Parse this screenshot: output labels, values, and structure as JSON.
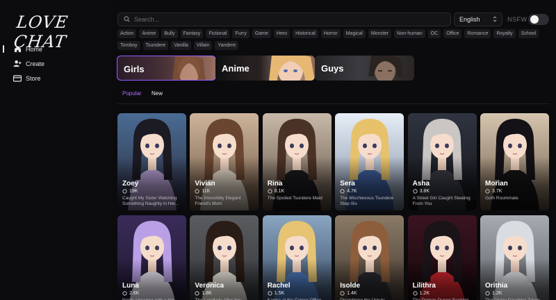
{
  "app": {
    "logo": "LOVE CHAT"
  },
  "sidebar": {
    "items": [
      {
        "label": "Home",
        "icon": "home-icon",
        "active": true
      },
      {
        "label": "Create",
        "icon": "add-user-icon",
        "active": false
      },
      {
        "label": "Store",
        "icon": "store-icon",
        "active": false
      }
    ]
  },
  "header": {
    "search_placeholder": "Search...",
    "language": "English",
    "nsfw_label": "NSFW",
    "nsfw_enabled": false
  },
  "tags": [
    "Action",
    "Anime",
    "Bully",
    "Fantasy",
    "Fictional",
    "Furry",
    "Game",
    "Hero",
    "Historical",
    "Horror",
    "Magical",
    "Monster",
    "Non-human",
    "OC",
    "Office",
    "Romance",
    "Royalty",
    "School",
    "Tomboy",
    "Tsundere",
    "Vanilla",
    "Villain",
    "Yandere"
  ],
  "categories": [
    {
      "label": "Girls",
      "selected": true
    },
    {
      "label": "Anime",
      "selected": false
    },
    {
      "label": "Guys",
      "selected": false
    }
  ],
  "sort": {
    "popular": "Popular",
    "new": "New",
    "active": "popular"
  },
  "colors": {
    "accent": "#9b5cff",
    "accent_text": "#b46cff",
    "background": "#0b0b0d"
  },
  "cards": [
    {
      "name": "Zoey",
      "likes": "19K",
      "desc": "Caught My Sister Watching Something Naughty in Her...",
      "bg": [
        "#4a6c94",
        "#2b2b3c"
      ],
      "hair": "#1c1a22",
      "outfit": "#b9a2d8"
    },
    {
      "name": "Vivian",
      "likes": "11K",
      "desc": "The Irresistibly Elegant Friend's Mom",
      "bg": [
        "#cdb49a",
        "#6e5544"
      ],
      "hair": "#6a4630",
      "outfit": "#e9dccd"
    },
    {
      "name": "Rina",
      "likes": "8.1K",
      "desc": "The Spoiled Tsundere Maid",
      "bg": [
        "#c8b9a8",
        "#5f5044"
      ],
      "hair": "#4a3226",
      "outfit": "#1a1a1e"
    },
    {
      "name": "Sera",
      "likes": "4.7K",
      "desc": "The Mischievous Tsundere Step-Sis",
      "bg": [
        "#e7eef7",
        "#7c8aa0"
      ],
      "hair": "#e8c26a",
      "outfit": "#3e5f9c"
    },
    {
      "name": "Asha",
      "likes": "3.8K",
      "desc": "A Street Girl Caught Stealing From You",
      "bg": [
        "#2f3440",
        "#141418"
      ],
      "hair": "#c9c6c4",
      "outfit": "#3a3c44"
    },
    {
      "name": "Morian",
      "likes": "3.7K",
      "desc": "Goth Roommate",
      "bg": [
        "#d6c6b0",
        "#6b5a48"
      ],
      "hair": "#141216",
      "outfit": "#151517"
    },
    {
      "name": "Luna",
      "likes": "2.6K",
      "desc": "Nerdy streamer with a big secret...",
      "bg": [
        "#3a2c5a",
        "#1a1428"
      ],
      "hair": "#b9a0e6",
      "outfit": "#ece8f2"
    },
    {
      "name": "Veronica",
      "likes": "1.8K",
      "desc": "The Landlady After You...",
      "bg": [
        "#5a5c60",
        "#2e3034"
      ],
      "hair": "#2a1c16",
      "outfit": "#f0ebe2"
    },
    {
      "name": "Rachel",
      "likes": "1.5K",
      "desc": "Karma at the Corner Office",
      "bg": [
        "#8aa6c2",
        "#2c3d56"
      ],
      "hair": "#e6c474",
      "outfit": "#4c78b8"
    },
    {
      "name": "Isolde",
      "likes": "1.4K",
      "desc": "Disciplining the Unruly...",
      "bg": [
        "#8a7a66",
        "#3a3028"
      ],
      "hair": "#8e5e3c",
      "outfit": "#2a2a30"
    },
    {
      "name": "Lilithra",
      "likes": "1.2K",
      "desc": "The Demon Queen Seeking...",
      "bg": [
        "#3a1420",
        "#120608"
      ],
      "hair": "#1a1418",
      "outfit": "#d0262e"
    },
    {
      "name": "Orithia",
      "likes": "1.2K",
      "desc": "The Divine Daughter Taken...",
      "bg": [
        "#a8acb2",
        "#4e5258"
      ],
      "hair": "#d9dde2",
      "outfit": "#e8eaee"
    }
  ]
}
